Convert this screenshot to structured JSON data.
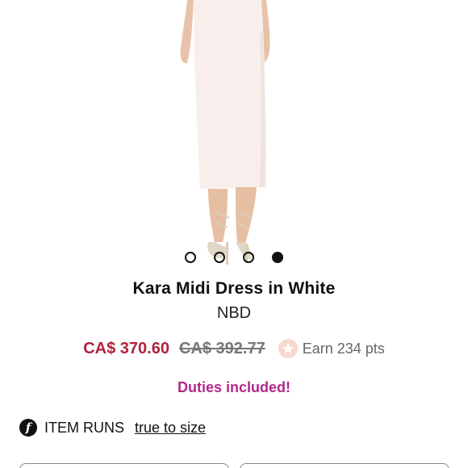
{
  "product": {
    "title": "Kara Midi Dress in White",
    "brand": "NBD",
    "sale_price": "CA$ 370.60",
    "original_price": "CA$ 392.77",
    "points": "Earn 234 pts",
    "duties": "Duties included!"
  },
  "carousel": {
    "total": 4,
    "active_index": 3
  },
  "fit": {
    "label": "ITEM RUNS",
    "value": "true to size",
    "icon": "f-logo-icon"
  },
  "colors": {
    "sale": "#b0223a",
    "duties": "#b1278a",
    "points_badge": "#f7d9d2"
  }
}
